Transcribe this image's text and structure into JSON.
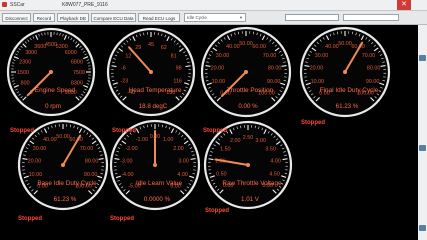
{
  "window": {
    "app_name": "SSCar",
    "document": "K8W077_PRE_9116",
    "close_icon": "close-icon"
  },
  "toolbar": {
    "buttons": [
      "Disconnect",
      "Record",
      "Playback DB",
      "Compare ECU Data",
      "Read ECU Logs"
    ],
    "select_value": "Idle Cycle",
    "progress": 0.0
  },
  "gauges": [
    {
      "label": "Engine Speed",
      "value_text": "0 rpm",
      "value": 0,
      "min": 0,
      "max": 9000,
      "ticks": [
        "0",
        "800",
        "1500",
        "2300",
        "3000",
        "3600",
        "4500",
        "5300",
        "6000",
        "6800",
        "7500",
        "8300",
        "9000"
      ],
      "status": "Stopped"
    },
    {
      "label": "Head Temperature",
      "value_text": "18.8 degC",
      "value": 18.8,
      "min": -40,
      "max": 130,
      "ticks": [
        "-40",
        "-23",
        "-6",
        "12",
        "29",
        "45",
        "62",
        "81",
        "98",
        "116",
        "130"
      ],
      "status": "Stopped"
    },
    {
      "label": "Throttle Position",
      "value_text": "0.00 %",
      "value": 0,
      "min": 0,
      "max": 100,
      "ticks": [
        "0.00",
        "10.00",
        "20.00",
        "30.00",
        "40.00",
        "50.00",
        "60.00",
        "70.00",
        "80.00",
        "90.00",
        "100.00"
      ],
      "status": "Stopped"
    },
    {
      "label": "Final Idle Duty Cycle",
      "value_text": "61.23 %",
      "value": 61.23,
      "min": 0,
      "max": 100,
      "ticks": [
        "0.00",
        "10.00",
        "20.00",
        "30.00",
        "40.00",
        "50.00",
        "60.00",
        "70.00",
        "80.00",
        "90.00",
        "100.00"
      ],
      "status": "Stopped"
    },
    {
      "label": "Base Idle Duty Cycle",
      "value_text": "61.23 %",
      "value": 61.23,
      "min": 0,
      "max": 100,
      "ticks": [
        "0.00",
        "10.00",
        "20.00",
        "30.00",
        "40.00",
        "50.00",
        "60.00",
        "70.00",
        "80.00",
        "90.00",
        "100.00"
      ],
      "status": "Stopped"
    },
    {
      "label": "Idle Learn Value",
      "value_text": "0.0000 %",
      "value": 0,
      "min": -5,
      "max": 5,
      "ticks": [
        "-5.00",
        "-4.00",
        "-3.00",
        "-2.00",
        "-1.00",
        "0.00",
        "1.00",
        "2.00",
        "3.00",
        "4.00",
        "5.00"
      ],
      "status": "Stopped"
    },
    {
      "label": "Raw Throttle Voltage",
      "value_text": "1.01 V",
      "value": 1.01,
      "min": 0,
      "max": 5,
      "ticks": [
        "0.00",
        "0.50",
        "1.00",
        "1.50",
        "2.00",
        "2.50",
        "3.00",
        "3.50",
        "4.00",
        "4.50",
        "5.00"
      ],
      "status": "Stopped"
    }
  ],
  "colors": {
    "ring": "#e8e8e8",
    "tick_label": "#e05a3a",
    "needle": "#f08a55",
    "status": "#ff4a3a",
    "gauge_text": "#ff6a4a"
  }
}
